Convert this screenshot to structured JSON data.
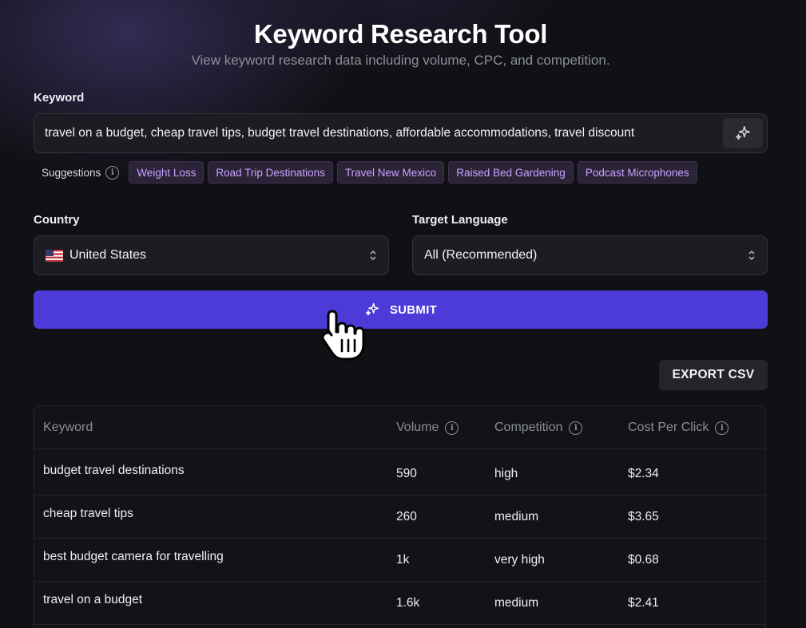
{
  "header": {
    "title": "Keyword Research Tool",
    "subtitle": "View keyword research data including volume, CPC, and competition."
  },
  "keyword": {
    "label": "Keyword",
    "value": "travel on a budget, cheap travel tips, budget travel destinations, affordable accommodations, travel discount",
    "magic_icon": "sparkles-icon"
  },
  "suggestions": {
    "label": "Suggestions",
    "items": [
      "Weight Loss",
      "Road Trip Destinations",
      "Travel New Mexico",
      "Raised Bed Gardening",
      "Podcast Microphones"
    ]
  },
  "country": {
    "label": "Country",
    "selected": "United States",
    "flag_icon": "us-flag-icon"
  },
  "language": {
    "label": "Target Language",
    "selected": "All (Recommended)"
  },
  "submit": {
    "label": "SUBMIT"
  },
  "export": {
    "label": "EXPORT CSV"
  },
  "table": {
    "columns": [
      "Keyword",
      "Volume",
      "Competition",
      "Cost Per Click"
    ],
    "rows": [
      {
        "keyword": "budget travel destinations",
        "volume": "590",
        "competition": "high",
        "cpc": "$2.34"
      },
      {
        "keyword": "cheap travel tips",
        "volume": "260",
        "competition": "medium",
        "cpc": "$3.65"
      },
      {
        "keyword": "best budget camera for travelling",
        "volume": "1k",
        "competition": "very high",
        "cpc": "$0.68"
      },
      {
        "keyword": "travel on a budget",
        "volume": "1.6k",
        "competition": "medium",
        "cpc": "$2.41"
      }
    ]
  },
  "colors": {
    "background": "#101115",
    "accent": "#4c3ad9",
    "chip_text": "#c8a2ff",
    "muted_text": "#8d8f99"
  }
}
